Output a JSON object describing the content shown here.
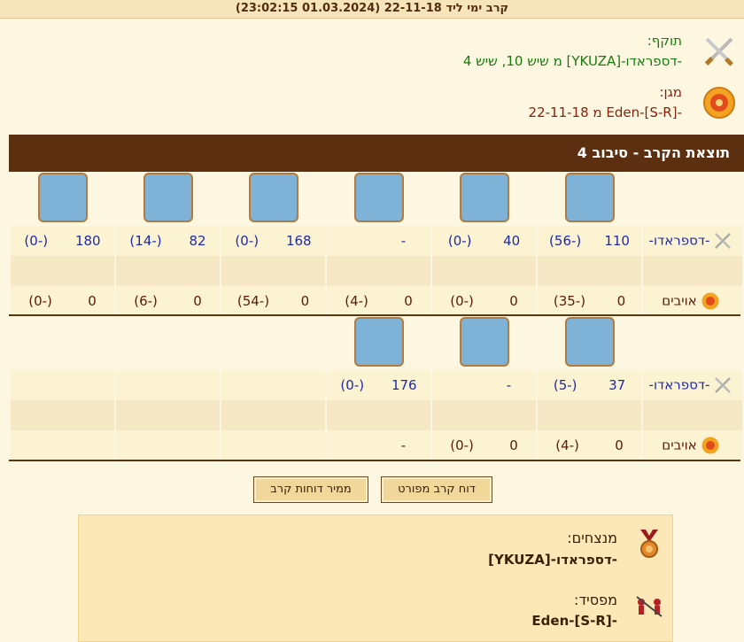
{
  "header": {
    "title": "קרב ימי ליד 22-11-18 (01.03.2024 23:02:15)"
  },
  "attacker": {
    "label": "תוקף:",
    "name": "-דספראדו-[YKUZA] מ שיש 10, שיש 4",
    "icon": "crossed-swords-icon"
  },
  "defender": {
    "label": "מגן:",
    "name": "-Eden-[S-R] מ 22-11-18",
    "icon": "shield-icon"
  },
  "result_header": "תוצאת הקרב - סיבוב 4",
  "round1": {
    "attacker_label": "-דספראדו-",
    "defender_label": "אויבים",
    "units": [
      {
        "icon": "steam-ram-ship-icon",
        "attacker": "110",
        "attacker_loss": "(-56)",
        "defender": "0",
        "defender_loss": "(-35)"
      },
      {
        "icon": "ballista-ship-icon",
        "attacker": "40",
        "attacker_loss": "(-0)",
        "defender": "0",
        "defender_loss": "(-0)"
      },
      {
        "icon": "ram-ship-icon",
        "attacker": "-",
        "attacker_loss": "",
        "defender": "0",
        "defender_loss": "(-4)"
      },
      {
        "icon": "fire-ship-icon",
        "attacker": "168",
        "attacker_loss": "(-0)",
        "defender": "0",
        "defender_loss": "(-54)"
      },
      {
        "icon": "mortar-ship-icon",
        "attacker": "82",
        "attacker_loss": "(-14)",
        "defender": "0",
        "defender_loss": "(-6)"
      },
      {
        "icon": "paddle-steamer-icon",
        "attacker": "180",
        "attacker_loss": "(-0)",
        "defender": "0",
        "defender_loss": "(-0)"
      }
    ]
  },
  "round2": {
    "attacker_label": "-דספראדו-",
    "defender_label": "אויבים",
    "units": [
      {
        "icon": "submarine-icon",
        "attacker": "37",
        "attacker_loss": "(-5)",
        "defender": "0",
        "defender_loss": "(-4)"
      },
      {
        "icon": "rocket-ship-icon",
        "attacker": "-",
        "attacker_loss": "",
        "defender": "0",
        "defender_loss": "(-0)"
      },
      {
        "icon": "diving-boat-icon",
        "attacker": "176",
        "attacker_loss": "(-0)",
        "defender": "-",
        "defender_loss": ""
      }
    ]
  },
  "buttons": {
    "detailed": "דוח קרב מפורט",
    "converter": "ממיר דוחות קרב"
  },
  "result": {
    "winners_label": "מנצחים:",
    "winners_name": "-דספראדו-[YKUZA]",
    "loser_label": "מפסיד:",
    "loser_name": "-Eden-[S-R]"
  },
  "colors": {
    "header_bg": "#5c2f10",
    "attacker_green": "#177a0c",
    "defender_red": "#8a1f0a",
    "value_blue": "#1f2aa6"
  }
}
